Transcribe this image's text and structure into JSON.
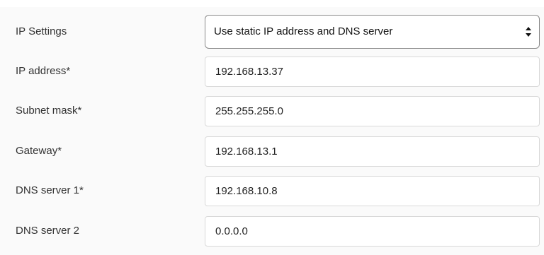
{
  "form": {
    "ip_settings": {
      "label": "IP Settings",
      "selected": "Use static IP address and DNS server"
    },
    "ip_address": {
      "label": "IP address*",
      "value": "192.168.13.37"
    },
    "subnet_mask": {
      "label": "Subnet mask*",
      "value": "255.255.255.0"
    },
    "gateway": {
      "label": "Gateway*",
      "value": "192.168.13.1"
    },
    "dns1": {
      "label": "DNS server 1*",
      "value": "192.168.10.8"
    },
    "dns2": {
      "label": "DNS server 2",
      "value": "0.0.0.0"
    }
  },
  "icons": {
    "select_arrows": "up-down-chevron-icon"
  }
}
